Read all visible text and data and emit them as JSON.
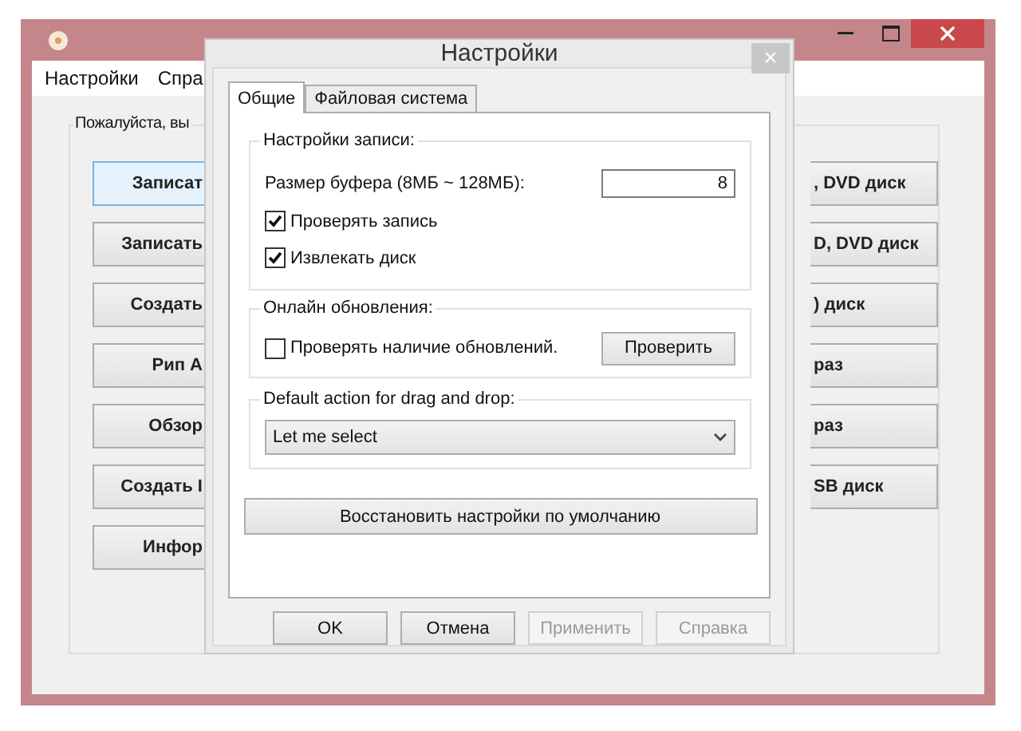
{
  "main_window": {
    "menu": [
      "Настройки",
      "Спра"
    ],
    "group_label": "Пожалуйста, вы",
    "left_buttons": [
      "Записат",
      "Записать",
      "Создать",
      "Рип А",
      "Обзор",
      "Создать I",
      "Инфор"
    ],
    "right_buttons": [
      ", DVD диск",
      "D, DVD диск",
      ") диск",
      "раз",
      "раз",
      "SB диск"
    ]
  },
  "dialog": {
    "title": "Настройки",
    "close": "×",
    "tabs": [
      {
        "label": "Общие",
        "selected": true
      },
      {
        "label": "Файловая система",
        "selected": false
      }
    ],
    "write_group": {
      "label": "Настройки записи:",
      "buffer_label": "Размер буфера (8МБ ~ 128МБ):",
      "buffer_value": "8",
      "checkboxes": [
        {
          "label": "Проверять запись",
          "checked": true
        },
        {
          "label": "Извлекать диск",
          "checked": true
        }
      ]
    },
    "update_group": {
      "label": "Онлайн обновления:",
      "checkbox": {
        "label": "Проверять наличие обновлений.",
        "checked": false
      },
      "button": "Проверить"
    },
    "drag_group": {
      "label": "Default action for drag and drop:",
      "value": "Let me select"
    },
    "restore_button": "Восстановить настройки по умолчанию",
    "buttons": [
      {
        "label": "OK",
        "disabled": false
      },
      {
        "label": "Отмена",
        "disabled": false
      },
      {
        "label": "Применить",
        "disabled": true
      },
      {
        "label": "Справка",
        "disabled": true
      }
    ]
  }
}
